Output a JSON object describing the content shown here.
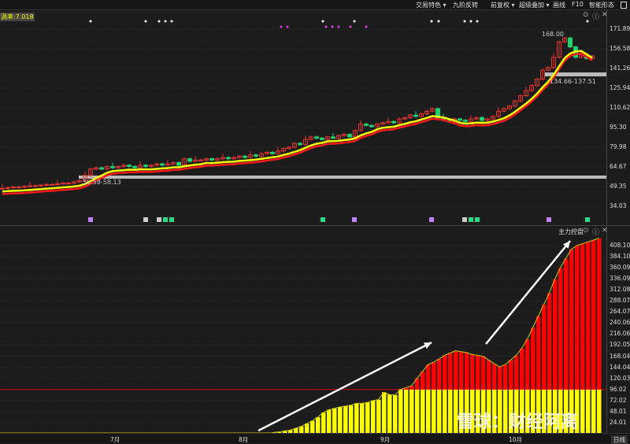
{
  "toolbar": {
    "items": [
      "交易特色 ▾",
      "九阶反转",
      "前复权 ▾",
      "超级叠加 ▾",
      "画线",
      "F10",
      "智能形态"
    ]
  },
  "indicator_label": "涡率:7.018",
  "price_axis": [
    "171.89",
    "156.58",
    "141.26",
    "125.94",
    "110.62",
    "95.30",
    "79.98",
    "64.67",
    "49.35",
    "34.03"
  ],
  "annotations": {
    "high": "168.00",
    "range_upper": "134.66-137.51",
    "range_lower": "56.58-58.13"
  },
  "sub_panel": {
    "title": "主力控盘",
    "threshold": 96.02,
    "axis": [
      "408.10",
      "384.10",
      "360.09",
      "336.09",
      "312.08",
      "288.07",
      "264.07",
      "240.06",
      "216.06",
      "192.05",
      "168.04",
      "144.04",
      "120.03",
      "96.02",
      "72.02",
      "48.01",
      "24.01"
    ]
  },
  "x_axis": [
    "7月",
    "8月",
    "9月",
    "10月"
  ],
  "period": "日线",
  "watermark": "雪球：财经阿离",
  "colors": {
    "up": "#e8322d",
    "down": "#1ed36e",
    "ma_fast": "#ffff00",
    "ma_slow": "#ff1a1a",
    "bar_low": "#ffff00",
    "bar_high": "#ff0000"
  },
  "chart_data": {
    "type": "candlestick",
    "closes": [
      48,
      48.5,
      49,
      49,
      49.5,
      50,
      50,
      50.5,
      51,
      51,
      51.5,
      52,
      52,
      53,
      54,
      58,
      63,
      64,
      63,
      65,
      64,
      65,
      66,
      65,
      64,
      66,
      65,
      66,
      67,
      66,
      67,
      68,
      66,
      71,
      69,
      70,
      70,
      71,
      70,
      71,
      72,
      71,
      72,
      73,
      72,
      74,
      73,
      75,
      76,
      75,
      77,
      79,
      80,
      83,
      82,
      86,
      88,
      87,
      86,
      88,
      87,
      89,
      90,
      88,
      93,
      98,
      97,
      96,
      98,
      99,
      100,
      99,
      102,
      103,
      105,
      104,
      106,
      108,
      110,
      103,
      101,
      100,
      102,
      101,
      100,
      102,
      103,
      101,
      102,
      104,
      108,
      110,
      112,
      116,
      120,
      124,
      128,
      133,
      140,
      142,
      150,
      162,
      165,
      158,
      150,
      152,
      149,
      151
    ],
    "sub_values": [
      3,
      4,
      6,
      8,
      12,
      16,
      22,
      28,
      36,
      46,
      52,
      55,
      58,
      60,
      62,
      66,
      66,
      68,
      72,
      74,
      90,
      85,
      84,
      96,
      100,
      104,
      120,
      135,
      150,
      155,
      162,
      170,
      175,
      180,
      178,
      176,
      172,
      170,
      168,
      160,
      152,
      145,
      150,
      160,
      170,
      185,
      205,
      230,
      255,
      280,
      305,
      335,
      360,
      380,
      400,
      408,
      412,
      416,
      420,
      424
    ],
    "price_range": [
      34.03,
      171.89
    ],
    "sub_range": [
      0,
      408.1
    ]
  }
}
